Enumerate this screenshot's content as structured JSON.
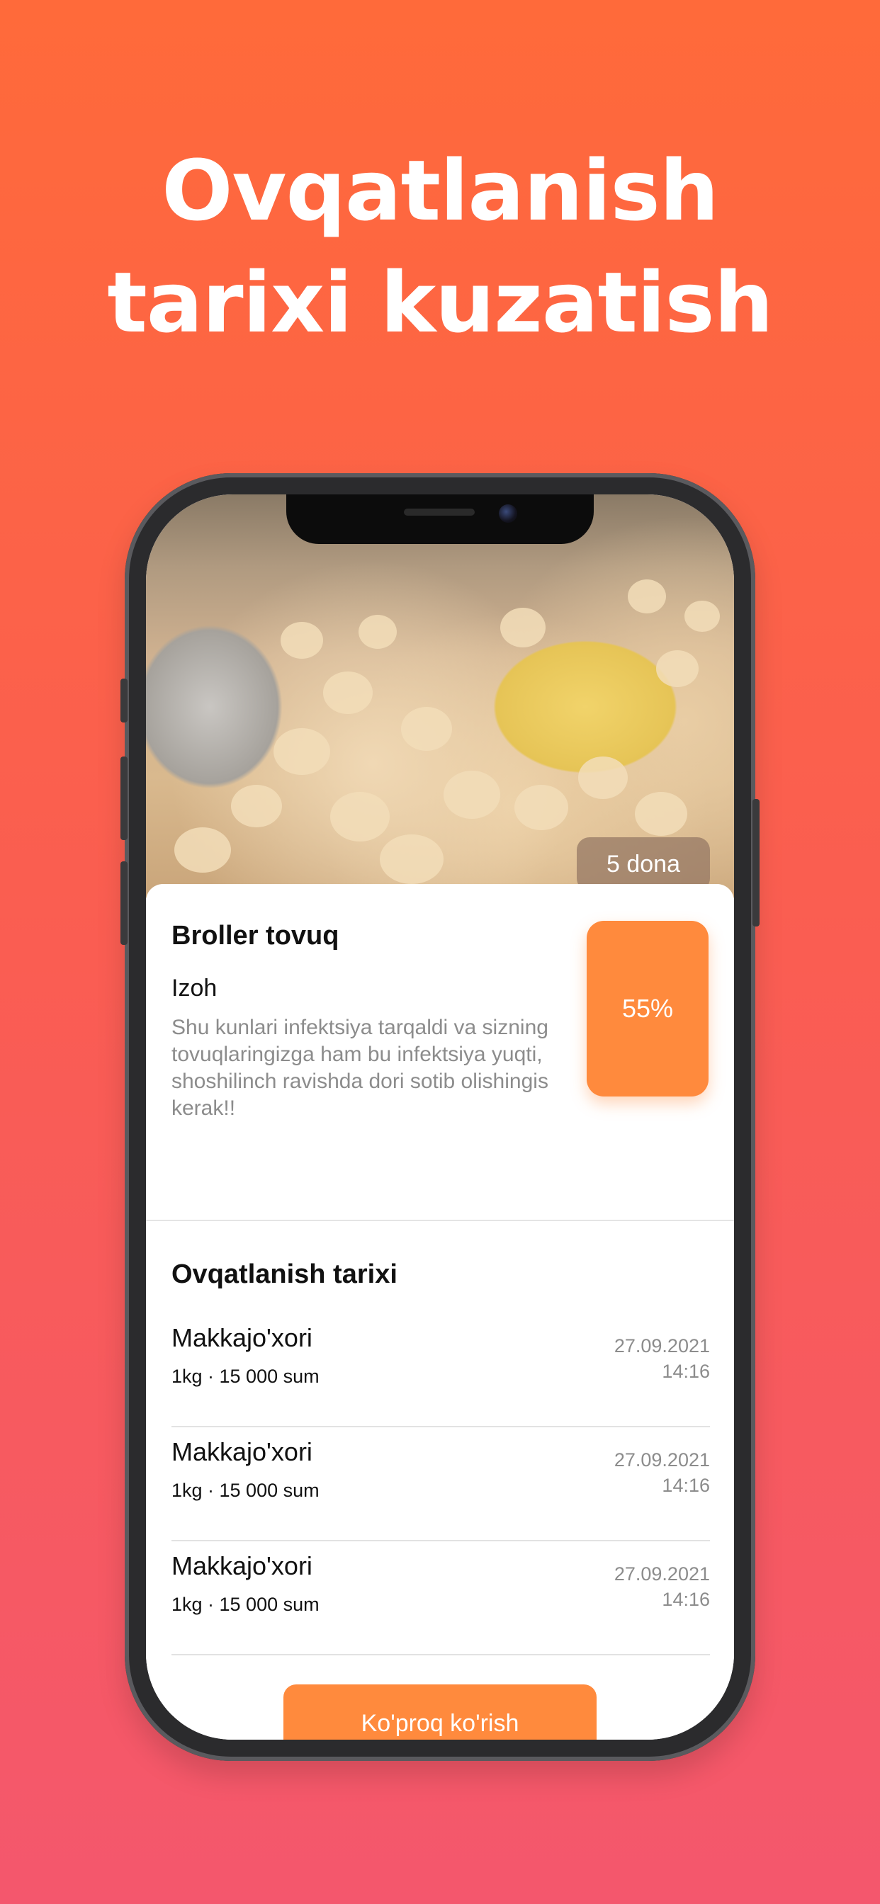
{
  "headline": {
    "line1": "Ovqatlanish",
    "line2": "tarixi kuzatish"
  },
  "photo": {
    "count_badge": "5 dona"
  },
  "card": {
    "title": "Broller tovuq",
    "note_label": "Izoh",
    "note_text": "Shu kunlari infektsiya tarqaldi va sizning tovuqlaringizga ham bu infektsiya yuqti, shoshilinch ravishda dori sotib olishingis kerak!!",
    "percent": "55%"
  },
  "history": {
    "title": "Ovqatlanish tarixi",
    "items": [
      {
        "name": "Makkajo'xori",
        "meta": "1kg · 15 000 sum",
        "date": "27.09.2021",
        "time": "14:16"
      },
      {
        "name": "Makkajo'xori",
        "meta": "1kg · 15 000 sum",
        "date": "27.09.2021",
        "time": "14:16"
      },
      {
        "name": "Makkajo'xori",
        "meta": "1kg · 15 000 sum",
        "date": "27.09.2021",
        "time": "14:16"
      }
    ],
    "more_label": "Ko'proq ko'rish"
  },
  "colors": {
    "background_top": "#ff6a3a",
    "background_bottom": "#f4576d",
    "accent": "#ff8a3d"
  }
}
